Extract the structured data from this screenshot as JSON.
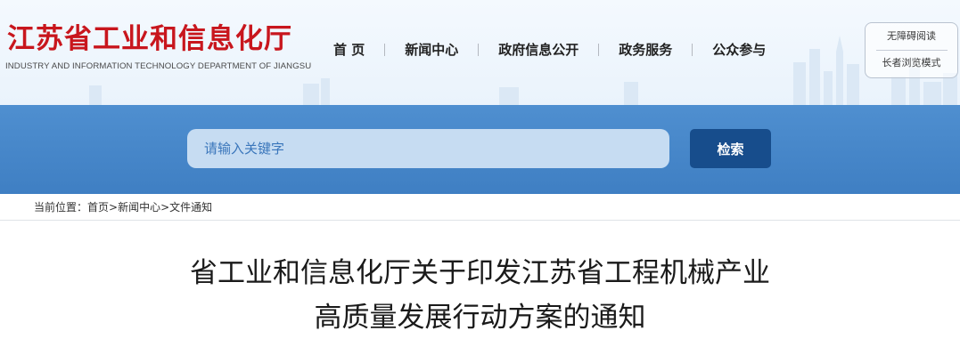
{
  "header": {
    "logo_cn": "江苏省工业和信息化厅",
    "logo_en": "INDUSTRY AND INFORMATION TECHNOLOGY DEPARTMENT OF JIANGSU",
    "nav": [
      {
        "label": "首 页"
      },
      {
        "label": "新闻中心"
      },
      {
        "label": "政府信息公开"
      },
      {
        "label": "政务服务"
      },
      {
        "label": "公众参与"
      }
    ],
    "accessibility": {
      "barrier_free_label": "无障碍阅读",
      "elderly_mode_label": "长者浏览模式"
    }
  },
  "search": {
    "placeholder": "请输入关键字",
    "button_label": "检索"
  },
  "breadcrumb": {
    "prefix": "当前位置：",
    "items": [
      "首页",
      "新闻中心",
      "文件通知"
    ],
    "separator": ">"
  },
  "article": {
    "title_line1": "省工业和信息化厅关于印发江苏省工程机械产业",
    "title_line2": "高质量发展行动方案的通知"
  },
  "colors": {
    "brand_red": "#c8161d",
    "search_band": "#4a8acb",
    "search_button": "#174d8c"
  }
}
